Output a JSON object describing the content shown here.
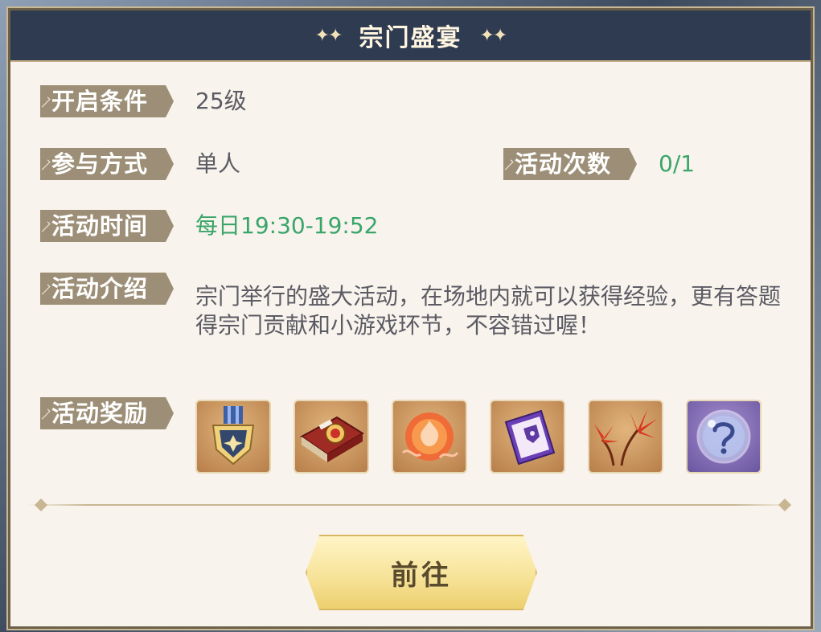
{
  "dialog": {
    "title": "宗门盛宴",
    "title_sparkle_left": "✦✦",
    "title_sparkle_right": "✦✦"
  },
  "info": {
    "open_condition_label": "开启条件",
    "open_condition_value": "25级",
    "participation_label": "参与方式",
    "participation_value": "单人",
    "count_label": "活动次数",
    "count_value": "0/1",
    "time_label": "活动时间",
    "time_value": "每日19:30-19:52",
    "intro_label": "活动介绍",
    "intro_value": "宗门举行的盛大活动，在场地内就可以获得经验，更有答题得宗门贡献和小游戏环节，不容错过喔！",
    "rewards_label": "活动奖励"
  },
  "rewards": [
    {
      "icon": "medal-icon"
    },
    {
      "icon": "book-icon"
    },
    {
      "icon": "flame-orb-icon"
    },
    {
      "icon": "ticket-icon"
    },
    {
      "icon": "red-flower-icon"
    },
    {
      "icon": "mystery-bubble-icon"
    }
  ],
  "actions": {
    "go_label": "前往"
  },
  "colors": {
    "title_bar": "#2e3b51",
    "label_bg": "#9d8f77",
    "highlight_green": "#3aa56a",
    "button_gold": "#f7e49a"
  }
}
